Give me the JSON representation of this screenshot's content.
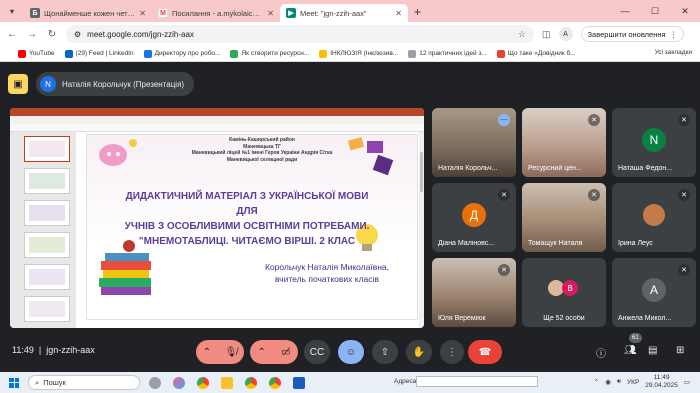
{
  "browser": {
    "tabs": [
      {
        "title": "Щонайменше кожен четвертий ш",
        "favicon": "Б",
        "color": "#5f6368",
        "active": false
      },
      {
        "title": "Посилання - a.mykolaichuk@vipp",
        "favicon": "M",
        "color": "#ea4335",
        "active": false
      },
      {
        "title": "Meet: \"jgn-zzih-aax\"",
        "favicon": "meet",
        "color": "#00897b",
        "active": true
      }
    ],
    "url": "meet.google.com/jgn-zzih-aax",
    "avatar_letter": "A",
    "update_button": "Завершити оновлення",
    "bookmarks": [
      {
        "label": "YouTube",
        "color": "#ff0000"
      },
      {
        "label": "(29) Feed | LinkedIn",
        "color": "#0a66c2"
      },
      {
        "label": "Директору про робо...",
        "color": "#1a73e8"
      },
      {
        "label": "Як створити ресурсн...",
        "color": "#34a853"
      },
      {
        "label": "ІНКЛЮЗІЯ (Інклюзив...",
        "color": "#fbbc04"
      },
      {
        "label": "12 практичних ідей з...",
        "color": "#9aa0a6"
      },
      {
        "label": "Що таке «Довідник б...",
        "color": "#ea4335"
      }
    ],
    "all_bookmarks": "Усі закладки"
  },
  "meet": {
    "presenter_initial": "N",
    "presenter_label": "Наталія Корольчук (Презентація)",
    "time": "11:49",
    "meeting_code": "jgn-zzih-aax",
    "participants_count": "61",
    "participants": [
      {
        "name": "Наталія Корольч...",
        "type": "photo",
        "color": "#8d7b6b"
      },
      {
        "name": "Ресурсний цен...",
        "type": "photo",
        "color": "#b79a8a"
      },
      {
        "name": "Наташа Федон...",
        "type": "avatar",
        "initial": "N",
        "color": "#0b8043"
      },
      {
        "name": "Діана Маліновс...",
        "type": "avatar",
        "initial": "Д",
        "color": "#e8710a"
      },
      {
        "name": "Томащук Наталя",
        "type": "photo",
        "color": "#a58d76"
      },
      {
        "name": "Ірина Леус",
        "type": "small-photo",
        "color": "#c47b4a"
      },
      {
        "name": "Юля Вереміюк",
        "type": "photo",
        "color": "#9c8470"
      },
      {
        "name": "Ще 52 особи",
        "type": "more",
        "initial": "B",
        "color": "#d81b60"
      },
      {
        "name": "Анжела Микол...",
        "type": "avatar",
        "initial": "A",
        "color": "#5f6368"
      }
    ]
  },
  "slide": {
    "header_lines": [
      "Камінь-Каширський район",
      "Маневицька ТГ",
      "Маневицький ліцей №1 імені Героя України Андрія Сітка",
      "Маневицької селищної ради"
    ],
    "title_lines": [
      "ДИДАКТИЧНИЙ МАТЕРІАЛ З УКРАЇНСЬКОЇ МОВИ ДЛЯ",
      "УЧНІВ З ОСОБЛИВИМИ ОСВІТНІМИ ПОТРЕБАМИ.",
      "\"МНЕМОТАБЛИЦІ. ЧИТАЄМО ВІРШІ. 2 КЛАС"
    ],
    "author_lines": [
      "Корольчук Наталія Миколаївна,",
      "вчитель початкових класів"
    ]
  },
  "taskbar": {
    "search": "Пошук",
    "address_label": "Адреса",
    "lang": "УКР",
    "clock_time": "11:49",
    "clock_date": "29.04.2025"
  }
}
